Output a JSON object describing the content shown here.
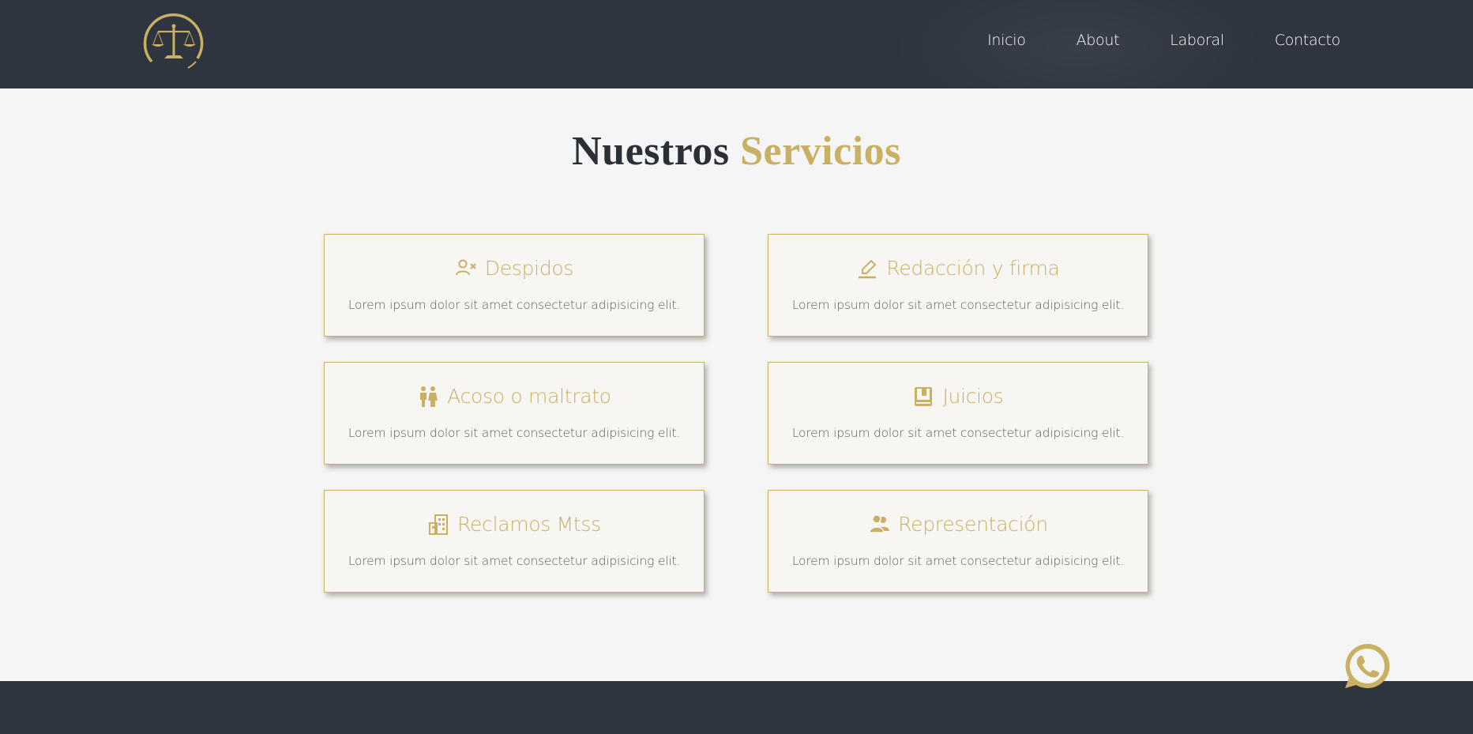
{
  "header": {
    "logo_icon": "scales-of-justice-icon",
    "nav": [
      {
        "label": "Inicio"
      },
      {
        "label": "About"
      },
      {
        "label": "Laboral"
      },
      {
        "label": "Contacto"
      }
    ]
  },
  "section": {
    "title_main": "Nuestros",
    "title_accent": "Servicios"
  },
  "services": [
    {
      "title": "Despidos",
      "icon": "user-remove-icon",
      "text": "Lorem ipsum dolor sit amet consectetur adipisicing elit."
    },
    {
      "title": "Redacción y firma",
      "icon": "pen-icon",
      "text": "Lorem ipsum dolor sit amet consectetur adipisicing elit."
    },
    {
      "title": "Acoso o maltrato",
      "icon": "people-icon",
      "text": "Lorem ipsum dolor sit amet consectetur adipisicing elit."
    },
    {
      "title": "Juicios",
      "icon": "book-icon",
      "text": "Lorem ipsum dolor sit amet consectetur adipisicing elit."
    },
    {
      "title": "Reclamos Mtss",
      "icon": "building-icon",
      "text": "Lorem ipsum dolor sit amet consectetur adipisicing elit."
    },
    {
      "title": "Representación",
      "icon": "user-group-icon",
      "text": "Lorem ipsum dolor sit amet consectetur adipisicing elit."
    }
  ],
  "whatsapp_icon": "whatsapp-icon",
  "colors": {
    "dark": "#2e353f",
    "gold": "#c9b063",
    "background": "#f5f5f5"
  }
}
